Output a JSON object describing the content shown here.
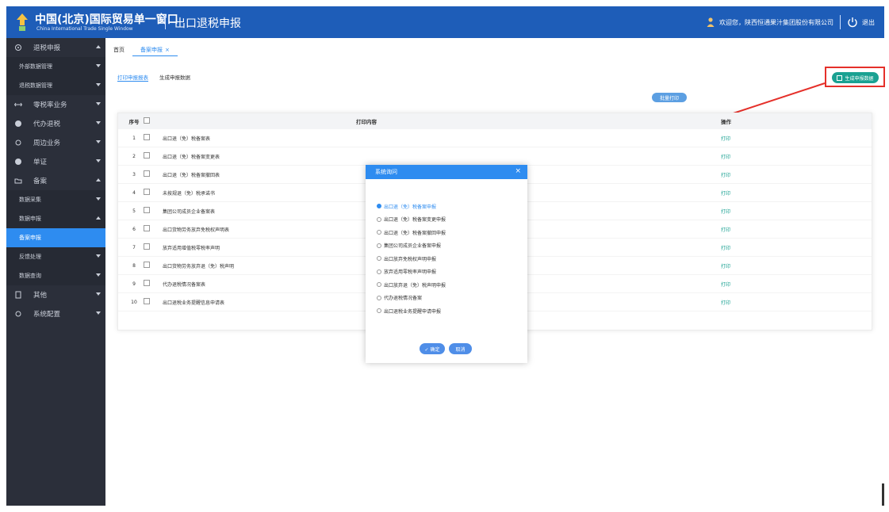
{
  "header": {
    "brand_cn": "中国(北京)国际贸易单一窗口",
    "brand_en": "China International Trade Single Window",
    "title": "出口退税申报",
    "welcome": "欢迎您，陕西恒通果汁集团股份有限公司",
    "logout": "退出"
  },
  "sidebar": {
    "items": [
      {
        "label": "退税申报"
      },
      {
        "label": "外部数据管理"
      },
      {
        "label": "退税数据管理"
      },
      {
        "label": "零税率业务"
      },
      {
        "label": "代办退税"
      },
      {
        "label": "周边业务"
      },
      {
        "label": "单证"
      },
      {
        "label": "备案"
      },
      {
        "label": "数据采集"
      },
      {
        "label": "数据申报"
      },
      {
        "label": "备案申报"
      },
      {
        "label": "反馈处理"
      },
      {
        "label": "数据查询"
      },
      {
        "label": "其他"
      },
      {
        "label": "系统配置"
      }
    ]
  },
  "tabs": {
    "home": "首页",
    "active": "备案申报",
    "close": "×"
  },
  "subtabs": {
    "print": "打印申报报表",
    "generate": "生成申报数据"
  },
  "actions": {
    "generate": "生成申报数据",
    "batch_print": "批量打印"
  },
  "table": {
    "headers": {
      "idx": "序号",
      "print_content": "打印内容",
      "op": "操作"
    },
    "rows": [
      {
        "idx": "1",
        "name": "出口退（免）税备案表",
        "op": "打印"
      },
      {
        "idx": "2",
        "name": "出口退（免）税备案变更表",
        "op": "打印"
      },
      {
        "idx": "3",
        "name": "出口退（免）税备案撤回表",
        "op": "打印"
      },
      {
        "idx": "4",
        "name": "未按规退（免）税承诺书",
        "op": "打印"
      },
      {
        "idx": "5",
        "name": "集团公司成员企业备案表",
        "op": "打印"
      },
      {
        "idx": "6",
        "name": "出口货物劳务放弃免税权声明表",
        "op": "打印"
      },
      {
        "idx": "7",
        "name": "放弃适用增值税零税率声明",
        "op": "打印"
      },
      {
        "idx": "8",
        "name": "出口货物劳务放弃退（免）税声明",
        "op": "打印"
      },
      {
        "idx": "9",
        "name": "代办退税情况备案表",
        "op": "打印"
      },
      {
        "idx": "10",
        "name": "出口退税业务提醒信息申请表",
        "op": "打印"
      }
    ]
  },
  "modal": {
    "title": "系统询问",
    "close": "×",
    "options": [
      {
        "label": "出口退（免）税备案申报",
        "selected": true
      },
      {
        "label": "出口退（免）税备案变更申报",
        "selected": false
      },
      {
        "label": "出口退（免）税备案撤回申报",
        "selected": false
      },
      {
        "label": "集团公司成员企业备案申报",
        "selected": false
      },
      {
        "label": "出口放弃免税权声明申报",
        "selected": false
      },
      {
        "label": "放弃适用零税率声明申报",
        "selected": false
      },
      {
        "label": "出口放弃退（免）税声明申报",
        "selected": false
      },
      {
        "label": "代办退税情况备案",
        "selected": false
      },
      {
        "label": "出口退税业务提醒申请申报",
        "selected": false
      }
    ],
    "ok": "✓ 确定",
    "cancel": "取消"
  }
}
